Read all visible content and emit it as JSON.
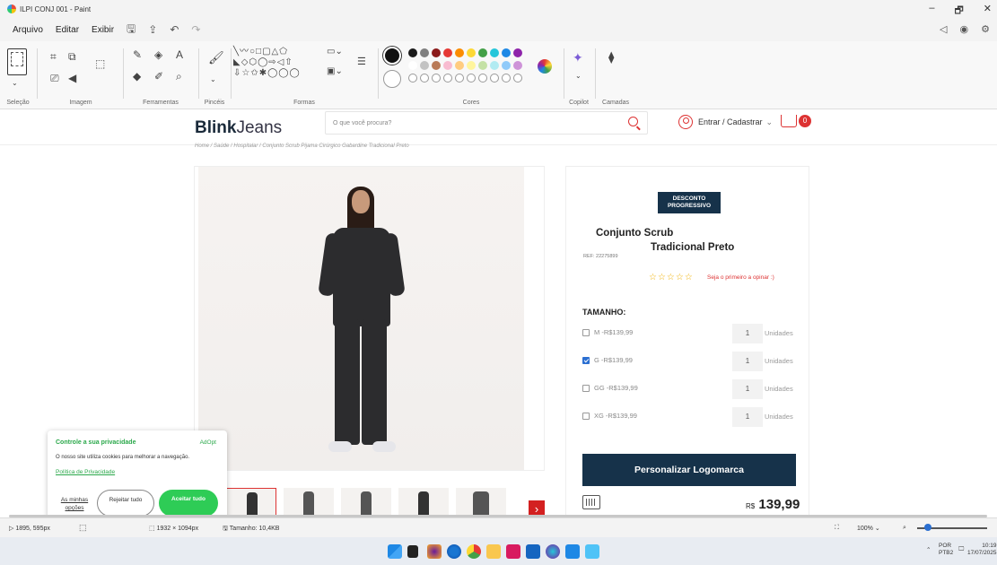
{
  "window": {
    "title": "ILPI CONJ 001 - Paint",
    "controls": [
      "–",
      "🗗",
      "✕"
    ]
  },
  "menu": {
    "items": [
      "Arquivo",
      "Editar",
      "Exibir"
    ]
  },
  "ribbon": {
    "groups": [
      "Seleção",
      "Imagem",
      "Ferramentas",
      "Pincéis",
      "Formas",
      "Cores",
      "Copilot",
      "Camadas"
    ],
    "colors_row1": [
      "#1a1a1a",
      "#7f7f7f",
      "#8b1a1a",
      "#e53935",
      "#fb8c00",
      "#fdd835",
      "#43a047",
      "#26c6da",
      "#1e88e5",
      "#8e24aa"
    ],
    "colors_row2": [
      "#ffffff",
      "#c3c3c3",
      "#b97a57",
      "#f8bbd0",
      "#ffcc80",
      "#fff59d",
      "#c5e1a5",
      "#b2ebf2",
      "#90caf9",
      "#ce93d8"
    ]
  },
  "site": {
    "logo_bold": "Blink",
    "logo_light": "Jeans",
    "search_placeholder": "O que você procura?",
    "login_label": "Entrar / Cadastrar",
    "cart_count": "0",
    "breadcrumb": "Home / Saúde / Hospitalar / Conjunto Scrub Pijama Cirúrgico Gabardine Tradicional Preto"
  },
  "product": {
    "badge": "DESCONTO PROGRESSIVO",
    "title_line1": "Conjunto Scrub",
    "title_line2": "Tradicional Preto",
    "ref": "REF: 22275899",
    "stars": "☆☆☆☆☆",
    "review_prompt": "Seja o primeiro a opinar :)",
    "size_label": "TAMANHO:",
    "sizes": [
      {
        "name": "M -R$139,99",
        "checked": false,
        "qty": "1",
        "unit": "Unidades"
      },
      {
        "name": "G -R$139,99",
        "checked": true,
        "qty": "1",
        "unit": "Unidades"
      },
      {
        "name": "GG -R$139,99",
        "checked": false,
        "qty": "1",
        "unit": "Unidades"
      },
      {
        "name": "XG -R$139,99",
        "checked": false,
        "qty": "1",
        "unit": "Unidades"
      }
    ],
    "cta": "Personalizar Logomarca",
    "currency": "R$",
    "price": "139,99",
    "thumb_next": "›"
  },
  "cookie": {
    "title": "Controle a sua privacidade",
    "brand": "AdOpt",
    "text": "O nosso site utiliza cookies para melhorar a navegação.",
    "policy_link": "Política de Privacidade",
    "options": "As minhas opções",
    "reject": "Rejeitar tudo",
    "accept": "Aceitar tudo"
  },
  "status": {
    "cursor": "1895, 595px",
    "dimensions": "1932 × 1094px",
    "size": "Tamanho: 10,4KB",
    "zoom": "100%"
  },
  "tray": {
    "lang1": "POR",
    "lang2": "PTB2",
    "time": "10:19",
    "date": "17/07/2025"
  }
}
